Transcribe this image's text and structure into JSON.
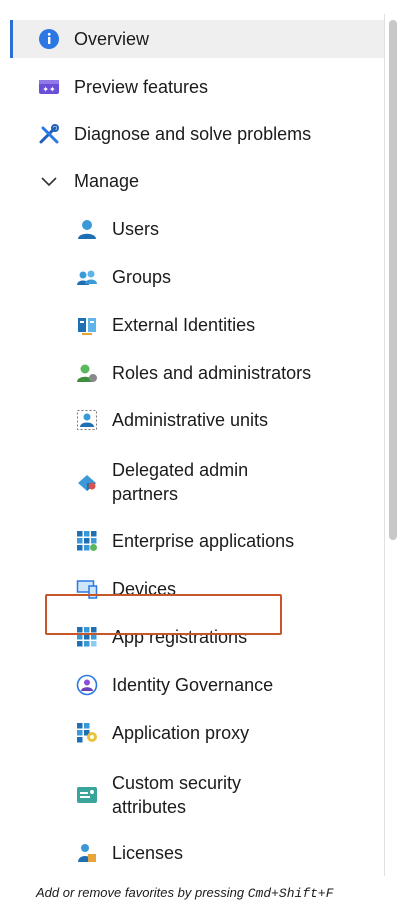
{
  "nav": {
    "overview": "Overview",
    "preview_features": "Preview features",
    "diagnose": "Diagnose and solve problems",
    "manage": "Manage",
    "users": "Users",
    "groups": "Groups",
    "external_identities": "External Identities",
    "roles": "Roles and administrators",
    "admin_units": "Administrative units",
    "delegated_line1": "Delegated admin",
    "delegated_line2": "partners",
    "enterprise_apps": "Enterprise applications",
    "devices": "Devices",
    "app_registrations": "App registrations",
    "identity_governance": "Identity Governance",
    "application_proxy": "Application proxy",
    "custom_line1": "Custom security",
    "custom_line2": "attributes",
    "licenses": "Licenses"
  },
  "footer": {
    "prefix": "Add or remove favorites by pressing ",
    "shortcut": "Cmd+Shift+F"
  },
  "colors": {
    "accent": "#2b6fd6",
    "highlight_border": "#c7562a"
  },
  "icons": [
    "info-icon",
    "preview-icon",
    "tools-icon",
    "chevron-down-icon",
    "user-icon",
    "group-icon",
    "external-id-icon",
    "roles-icon",
    "admin-units-icon",
    "delegated-icon",
    "enterprise-apps-icon",
    "devices-icon",
    "app-registrations-icon",
    "governance-icon",
    "app-proxy-icon",
    "custom-attributes-icon",
    "licenses-icon"
  ]
}
